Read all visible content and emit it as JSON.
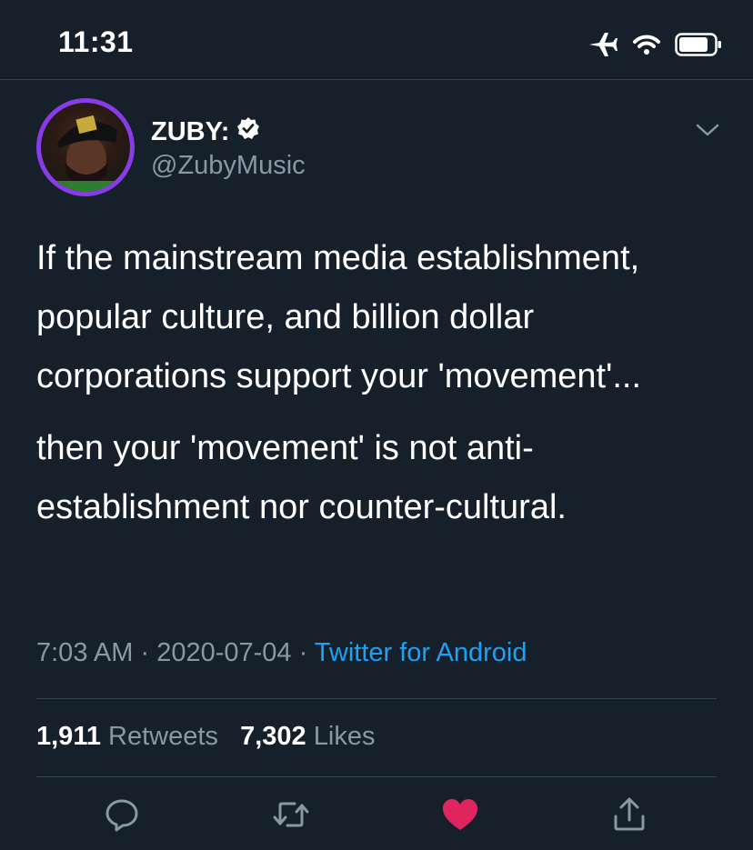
{
  "status_bar": {
    "time": "11:31",
    "icons": [
      "airplane-icon",
      "wifi-icon",
      "battery-icon"
    ]
  },
  "tweet": {
    "author": {
      "display_name": "ZUBY:",
      "handle": "@ZubyMusic",
      "verified": true
    },
    "text": {
      "paragraph_1": "If the mainstream media establishment, popular culture, and billion dollar corporations support your 'movement'...",
      "paragraph_2": "then your 'movement' is not anti-establishment nor counter-cultural."
    },
    "meta": {
      "time": "7:03 AM",
      "separator": " · ",
      "date": "2020-07-04",
      "source": "Twitter for Android"
    },
    "stats": {
      "retweets_count": "1,911",
      "retweets_label": "Retweets",
      "likes_count": "7,302",
      "likes_label": "Likes"
    },
    "actions": [
      "reply-icon",
      "retweet-icon",
      "like-icon",
      "share-icon"
    ]
  },
  "colors": {
    "background": "#15202b",
    "text": "#ffffff",
    "secondary": "#8899a6",
    "link": "#1da1f2",
    "like": "#e0245e",
    "divider": "#38444d",
    "avatar_ring": "#8a3be8"
  }
}
